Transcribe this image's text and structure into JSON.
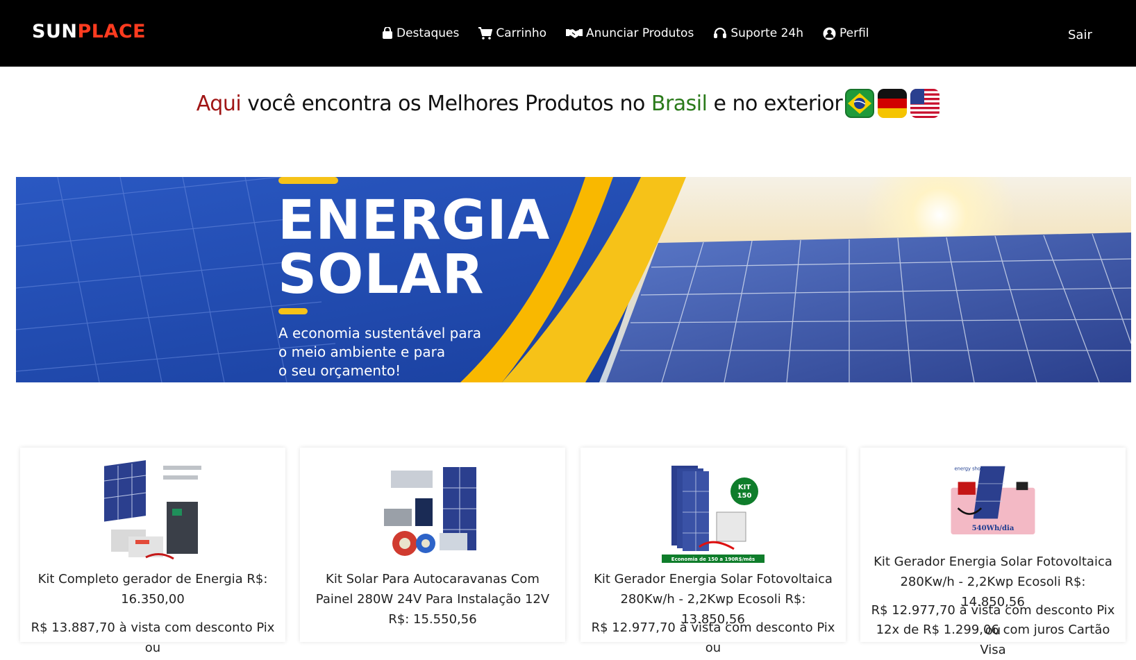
{
  "header": {
    "logo_part1": "SUN",
    "logo_part2": "PLACE",
    "nav": [
      {
        "label": "Destaques",
        "icon": "shopping-bag-icon"
      },
      {
        "label": "Carrinho",
        "icon": "cart-icon"
      },
      {
        "label": "Anunciar Produtos",
        "icon": "handshake-icon"
      },
      {
        "label": "Suporte 24h",
        "icon": "headset-icon"
      },
      {
        "label": "Perfil",
        "icon": "user-circle-icon"
      }
    ],
    "logout_label": "Sair"
  },
  "headline": {
    "part1": "Aqui",
    "part2": " você encontra os Melhores Produtos no ",
    "part3": "Brasil",
    "part4": " e no exterior",
    "flags": [
      "brazil-flag-icon",
      "germany-flag-icon",
      "usa-flag-icon"
    ]
  },
  "banner": {
    "title_line1": "ENERGIA",
    "title_line2": "SOLAR",
    "subtitle_line1": "A economia sustentável para",
    "subtitle_line2": "o meio ambiente e para",
    "subtitle_line3": "o seu orçamento!"
  },
  "products": [
    {
      "title": "Kit Completo gerador de Energia R$: 16.350,00",
      "price_text": "R$ 13.887,70 à vista com desconto Pix ou"
    },
    {
      "title": "Kit Solar Para Autocaravanas Com Painel 280W 24V Para Instalação 12V R$: 15.550,56",
      "price_text": ""
    },
    {
      "title": "Kit Gerador Energia Solar Fotovoltaica 280Kw/h - 2,2Kwp Ecosoli R$: 13.850,56",
      "price_text": "R$ 12.977,70 à vista com desconto Pix ou",
      "badge": "KIT 150",
      "banner_text": "Economia de 150 a 190R$/mês"
    },
    {
      "title": "Kit Gerador Energia Solar Fotovoltaica 280Kw/h - 2,2Kwp Ecosoli R$: 14.850,56",
      "price_text": "R$ 12.977,70 à vista com desconto Pix ou",
      "price_text2": "12x de R$ 1.299,06 com juros Cartão Visa",
      "badge_text": "540Wh/dia",
      "brand_text": "energy shop"
    }
  ],
  "colors": {
    "navbar_bg": "#000000",
    "logo_accent": "#ff3b1f",
    "headline_red": "#a01515",
    "headline_green": "#2a7a1a",
    "banner_blue": "#1a3f9e",
    "banner_yellow": "#f6c218"
  }
}
